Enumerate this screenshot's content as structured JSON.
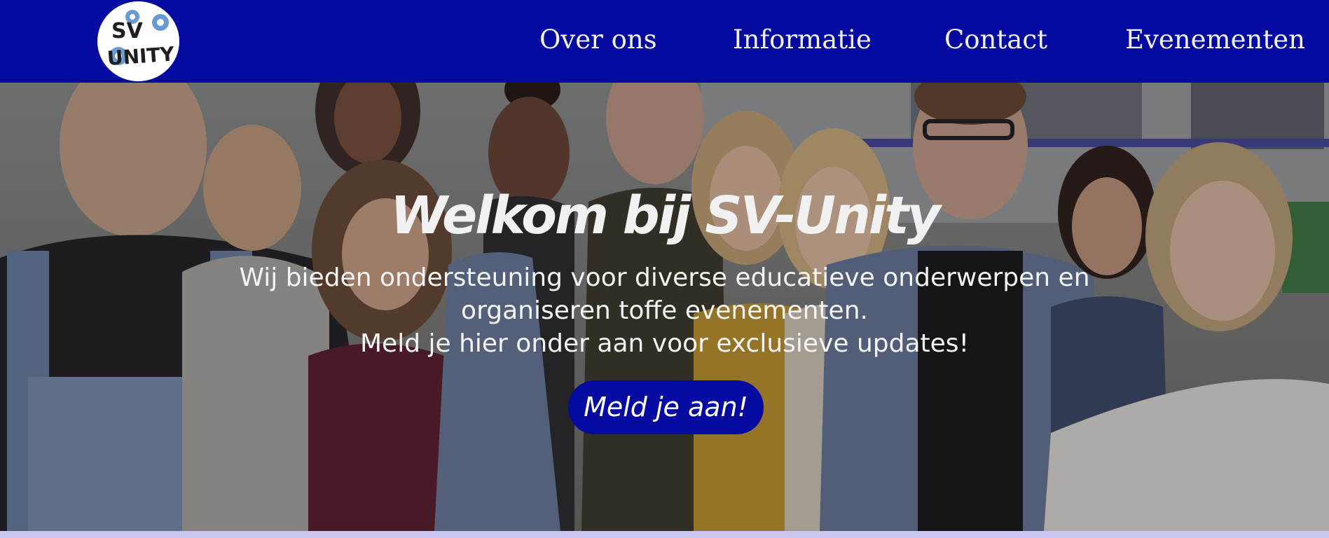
{
  "header": {
    "logo": {
      "icon": "sv-unity-logo",
      "text_top": "SV",
      "text_bottom": "UNITY"
    },
    "nav": [
      {
        "label": "Over ons"
      },
      {
        "label": "Informatie"
      },
      {
        "label": "Contact"
      },
      {
        "label": "Evenementen"
      }
    ],
    "background_color": "#050aa0"
  },
  "hero": {
    "title": "Welkom bij SV-Unity",
    "lines": [
      "Wij bieden ondersteuning voor diverse educatieve onderwerpen en",
      "organiseren toffe evenementen.",
      "Meld je hier onder aan voor exclusieve updates!"
    ],
    "cta_label": "Meld je aan!",
    "cta_color": "#050aa0",
    "image": "group-photo-of-students"
  }
}
